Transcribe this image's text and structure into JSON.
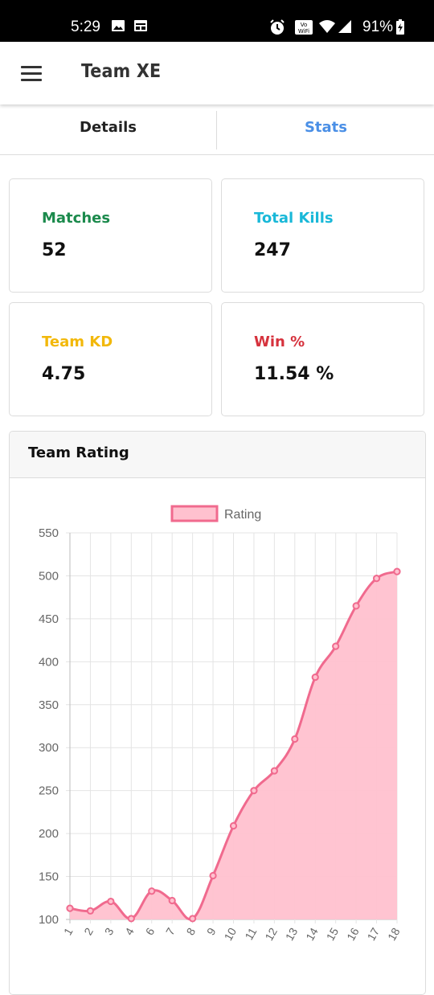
{
  "status_bar": {
    "time": "5:29",
    "battery": "91%",
    "left_icons": [
      "image-icon",
      "calendar-icon"
    ],
    "right_icons": [
      "alarm-icon",
      "wifi-calling-icon",
      "wifi-icon",
      "signal-icon",
      "battery-charging-icon"
    ]
  },
  "app_bar": {
    "title": "Team XE"
  },
  "tabs": [
    {
      "label": "Details",
      "active": false
    },
    {
      "label": "Stats",
      "active": true
    }
  ],
  "stats": {
    "matches": {
      "label": "Matches",
      "value": "52",
      "color": "#1b8a4c"
    },
    "total_kills": {
      "label": "Total Kills",
      "value": "247",
      "color": "#19b8d8"
    },
    "team_kd": {
      "label": "Team KD",
      "value": "4.75",
      "color": "#f2b80a"
    },
    "win_pct": {
      "label": "Win %",
      "value": "11.54 %",
      "color": "#d6323d"
    }
  },
  "rating_card": {
    "title": "Team Rating"
  },
  "chart_data": {
    "type": "area",
    "title": "",
    "xlabel": "",
    "ylabel": "",
    "x": [
      "1",
      "2",
      "3",
      "4",
      "6",
      "7",
      "8",
      "9",
      "10",
      "11",
      "12",
      "13",
      "14",
      "15",
      "16",
      "17",
      "18"
    ],
    "series": [
      {
        "name": "Rating",
        "values": [
          113,
          110,
          121,
          101,
          133,
          122,
          101,
          151,
          209,
          250,
          273,
          310,
          382,
          418,
          465,
          497,
          505
        ],
        "line_color": "#f06a8e",
        "fill_color": "#ffc1cf"
      }
    ],
    "y_ticks": [
      100,
      150,
      200,
      250,
      300,
      350,
      400,
      450,
      500,
      550
    ],
    "ylim": [
      100,
      550
    ],
    "grid": true,
    "legend": "top-center"
  }
}
